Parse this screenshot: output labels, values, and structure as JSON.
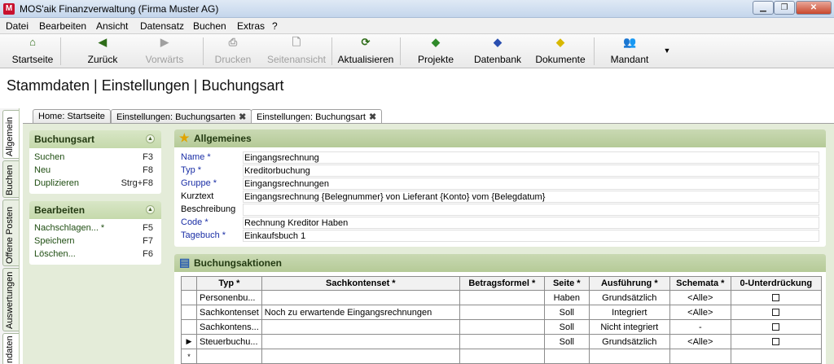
{
  "window": {
    "title": "MOS'aik Finanzverwaltung (Firma Muster AG)",
    "app_icon": "M"
  },
  "menu": [
    "Datei",
    "Bearbeiten",
    "Ansicht",
    "Datensatz",
    "Buchen",
    "Extras",
    "?"
  ],
  "toolbar": {
    "startseite": "Startseite",
    "zurueck": "Zurück",
    "vorwaerts": "Vorwärts",
    "drucken": "Drucken",
    "seitenansicht": "Seitenansicht",
    "aktualisieren": "Aktualisieren",
    "projekte": "Projekte",
    "datenbank": "Datenbank",
    "dokumente": "Dokumente",
    "mandant": "Mandant"
  },
  "heading": "Stammdaten | Einstellungen | Buchungsart",
  "vtabs": [
    "Allgemein",
    "Buchen",
    "Offene Posten",
    "Auswertungen",
    "ndaten"
  ],
  "doc_tabs": [
    "Home: Startseite",
    "Einstellungen: Buchungsarten",
    "Einstellungen: Buchungsart"
  ],
  "buchungsart_box": {
    "title": "Buchungsart",
    "items": [
      {
        "label": "Suchen",
        "key": "F3"
      },
      {
        "label": "Neu",
        "key": "F8"
      },
      {
        "label": "Duplizieren",
        "key": "Strg+F8"
      }
    ]
  },
  "bearbeiten_box": {
    "title": "Bearbeiten",
    "items": [
      {
        "label": "Nachschlagen... *",
        "key": "F5"
      },
      {
        "label": "Speichern",
        "key": "F7"
      },
      {
        "label": "Löschen...",
        "key": "F6"
      }
    ]
  },
  "allgemeines": {
    "title": "Allgemeines",
    "fields": [
      {
        "label": "Name *",
        "value": "Eingangsrechnung"
      },
      {
        "label": "Typ *",
        "value": "Kreditorbuchung"
      },
      {
        "label": "Gruppe *",
        "value": "Eingangsrechnungen"
      },
      {
        "label": "Kurztext",
        "value": "Eingangsrechnung {Belegnummer} von Lieferant {Konto} vom {Belegdatum}"
      },
      {
        "label": "Beschreibung",
        "value": ""
      },
      {
        "label": "Code *",
        "value": "Rechnung Kreditor Haben"
      },
      {
        "label": "Tagebuch *",
        "value": "Einkaufsbuch 1"
      }
    ]
  },
  "buchungsaktionen": {
    "title": "Buchungsaktionen",
    "columns": [
      "Typ *",
      "Sachkontenset *",
      "Betragsformel *",
      "Seite *",
      "Ausführung *",
      "Schemata *",
      "0-Unterdrückung"
    ],
    "rows": [
      {
        "marker": "",
        "cells": [
          "Personenbu...",
          "",
          "",
          "Haben",
          "Grundsätzlich",
          "<Alle>"
        ]
      },
      {
        "marker": "",
        "cells": [
          "Sachkontenset",
          "Noch zu erwartende Eingangsrechnungen",
          "",
          "Soll",
          "Integriert",
          "<Alle>"
        ]
      },
      {
        "marker": "",
        "cells": [
          "Sachkontens...",
          "",
          "",
          "Soll",
          "Nicht integriert",
          "-"
        ]
      },
      {
        "marker": "▶",
        "cells": [
          "Steuerbuchu...",
          "",
          "",
          "Soll",
          "Grundsätzlich",
          "<Alle>"
        ]
      },
      {
        "marker": "*",
        "cells": [
          "",
          "",
          "",
          "",
          "",
          ""
        ]
      }
    ]
  }
}
